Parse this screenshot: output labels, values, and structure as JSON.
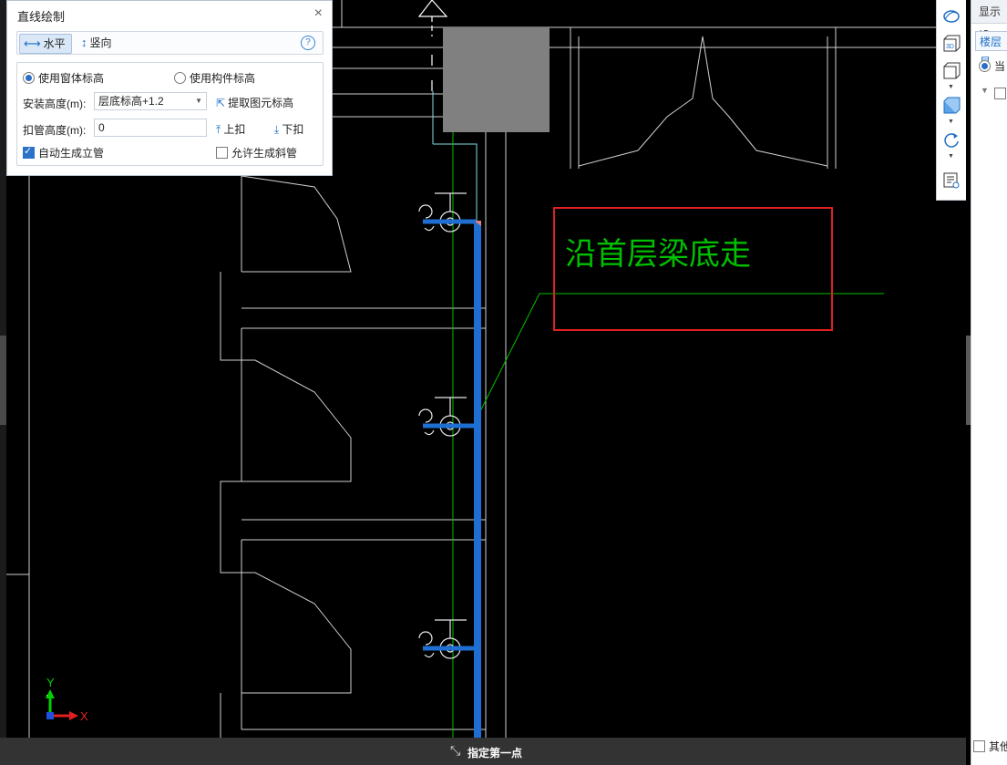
{
  "dialog": {
    "title": "直线绘制",
    "close": "×",
    "tab_horizontal": "水平",
    "tab_vertical": "竖向",
    "help": "?",
    "radio_window": "使用窗体标高",
    "radio_component": "使用构件标高",
    "install_height_label": "安装高度(m):",
    "install_height_value": "层底标高+1.2",
    "extract_elevation": "提取图元标高",
    "buckle_height_label": "扣管高度(m):",
    "buckle_height_value": "0",
    "buckle_up": "上扣",
    "buckle_down": "下扣",
    "auto_riser": "自动生成立管",
    "allow_slope": "允许生成斜管"
  },
  "annotation": {
    "text": "沿首层梁底走"
  },
  "axis": {
    "y": "Y",
    "x": "X"
  },
  "right_panel": {
    "header": "显示设",
    "tab": "楼层显",
    "radio": "当",
    "bottom_check": "其他"
  },
  "status": {
    "prompt": "指定第一点"
  },
  "colors": {
    "pipe": "#1565c0",
    "cad_lines": "#d0d0d0",
    "green": "#00c000",
    "highlight_box": "#e02020"
  }
}
